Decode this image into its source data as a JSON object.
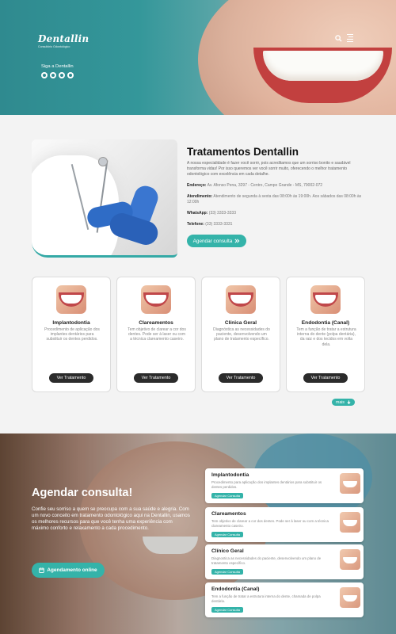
{
  "header": {
    "brand": "Dentallin",
    "brand_sub": "Consultório Odontológico",
    "follow": "Siga a Dentallin",
    "social_icons": [
      "instagram-icon",
      "facebook-icon",
      "youtube-icon",
      "whatsapp-icon"
    ]
  },
  "treatments": {
    "title": "Tratamentos Dentallin",
    "description": "A nossa especialidade é fazer você sorrir, pois acreditamos que um sorriso bonito e saudável transforma vidas! Por isso queremos ver você sorrir muito, oferecendo o melhor tratamento odontológico com excelência em cada detalhe.",
    "address_label": "Endereço:",
    "address": "Av. Afonso Pena, 3297 - Centro, Campo Grande - MS, 79002-072",
    "hours_label": "Atendimento:",
    "hours": "Atendimento de segunda à sexta das 08:00h às 19:00h. Aos sábados das 08:00h às 12:00h",
    "whatsapp_label": "WhatsApp:",
    "whatsapp": "(33) 3333-3333",
    "phone_label": "Telefone:",
    "phone": "(33) 3333-3331",
    "cta": "Agendar consulta",
    "cta_icon": "double-chevron-right-icon"
  },
  "cards": [
    {
      "title": "Implantodontia",
      "desc": "Procedimento de aplicação dos implantes dentários para substituir os dentes perdidos.",
      "button": "Ver Tratamento"
    },
    {
      "title": "Clareamentos",
      "desc": "Tem objetivo de clarear a cor dos dentes. Pode ser à laser ou com a técnica clareamento caseiro.",
      "button": "Ver Tratamento"
    },
    {
      "title": "Clínica Geral",
      "desc": "Diagnóstica as necessidades do paciente, desenvolvendo um plano de tratamento específico.",
      "button": "Ver Tratamento"
    },
    {
      "title": "Endodontia (Canal)",
      "desc": "Tem a função de tratar a estrutura interna do dente (polpa dentária), da raiz e dos tecidos em volta dela.",
      "button": "Ver Tratamento"
    }
  ],
  "more": {
    "label": "mais",
    "icon": "arrow-down-icon"
  },
  "appointment": {
    "title": "Agendar consulta!",
    "description": "Confie seu sorriso a quem se preocupa com a sua saúde e alegria. Com um novo conceito em tratamento odontológico aqui na Dentallin, usamos os melhores recursos para que você tenha uma experiência com máximo conforto e relaxamento a cada procedimento.",
    "button": "Agendamento online",
    "button_icon": "calendar-icon"
  },
  "services": [
    {
      "title": "Implantodontia",
      "desc": "Procedimento para aplicação dos implantes dentários para substituir os dentes perdidos.",
      "button": "Agendar Consulta"
    },
    {
      "title": "Clareamentos",
      "desc": "Tem objetivo de clarear a cor dos dentes. Pode ser à laser ou com a técnica clareamento caseiro.",
      "button": "Agendar Consulta"
    },
    {
      "title": "Clínico Geral",
      "desc": "Diagnostica as necessidades do paciente, desenvolvendo um plano de tratamento específico.",
      "button": "Agendar Consulta"
    },
    {
      "title": "Endodontia (Canal)",
      "desc": "Tem a função de tratar a estrutura interna do dente, chamada de polpa dentária.",
      "button": "Agendar Consulta"
    }
  ],
  "colors": {
    "teal": "#34b3a9",
    "dark": "#2b2b2b",
    "hero": "#2f8a8f"
  }
}
